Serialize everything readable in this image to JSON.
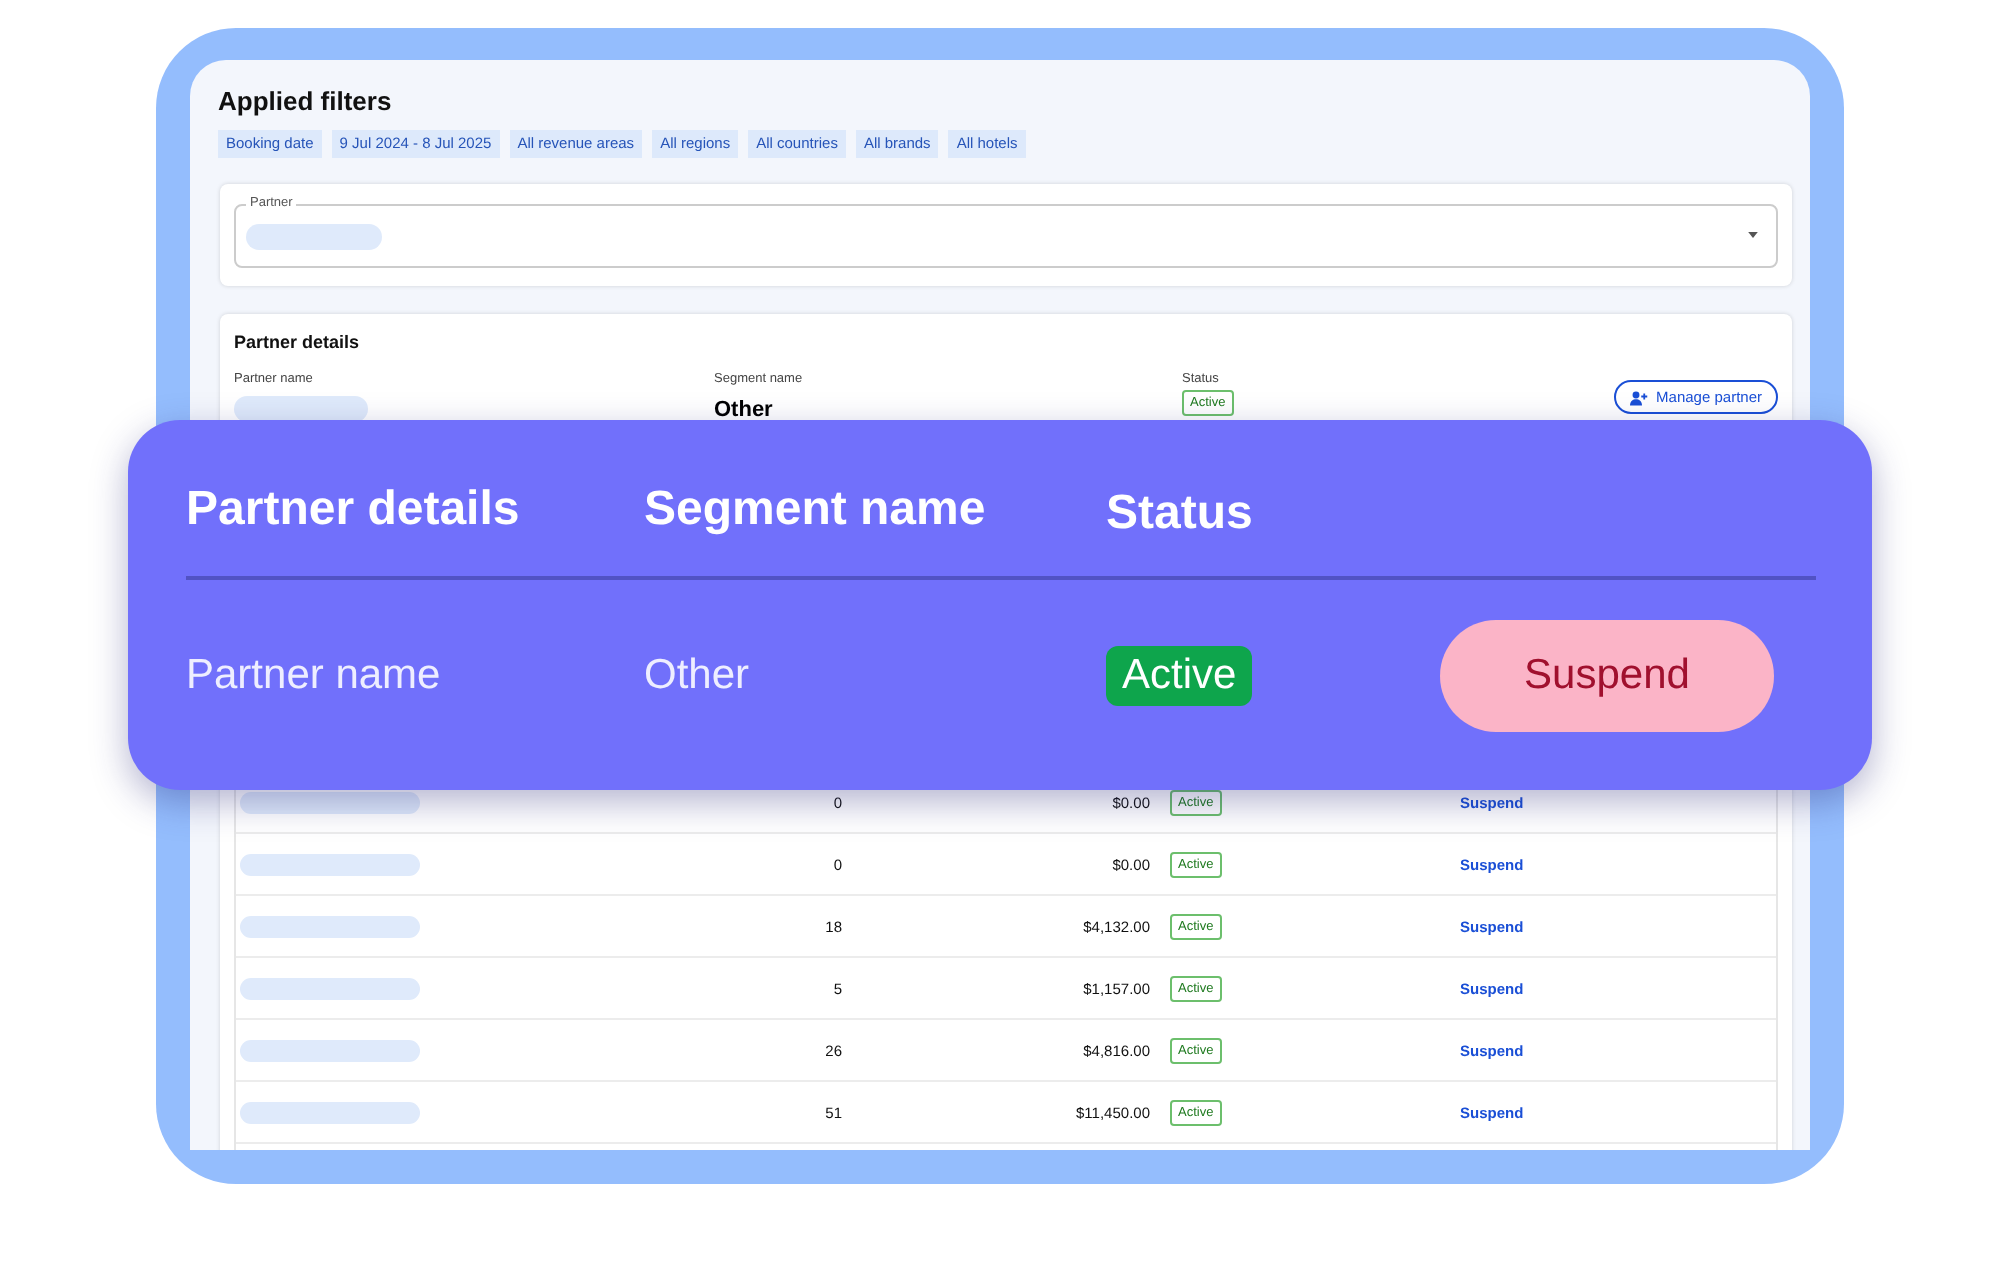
{
  "filters": {
    "title": "Applied filters",
    "chips": [
      "Booking date",
      "9 Jul 2024 - 8 Jul 2025",
      "All revenue areas",
      "All regions",
      "All countries",
      "All brands",
      "All hotels"
    ]
  },
  "partner_select": {
    "label": "Partner"
  },
  "partner_details": {
    "title": "Partner details",
    "fields": [
      {
        "label": "Partner name"
      },
      {
        "label": "Segment name",
        "value": "Other"
      },
      {
        "label": "Status",
        "value": "Active",
        "kind": "badge"
      }
    ],
    "manage_button": "Manage partner"
  },
  "table": {
    "rows": [
      {
        "column_2": "0",
        "column_3": "$0.00",
        "status": "Active",
        "action": "Suspend"
      },
      {
        "column_2": "0",
        "column_3": "$0.00",
        "status": "Active",
        "action": "Suspend"
      },
      {
        "column_2": "18",
        "column_3": "$4,132.00",
        "status": "Active",
        "action": "Suspend"
      },
      {
        "column_2": "5",
        "column_3": "$1,157.00",
        "status": "Active",
        "action": "Suspend"
      },
      {
        "column_2": "26",
        "column_3": "$4,816.00",
        "status": "Active",
        "action": "Suspend"
      },
      {
        "column_2": "51",
        "column_3": "$11,450.00",
        "status": "Active",
        "action": "Suspend"
      }
    ]
  },
  "callout": {
    "columns": [
      "Partner details",
      "Segment name",
      "Status"
    ],
    "row": {
      "name": "Partner name",
      "segment": "Other",
      "status": "Active",
      "action": "Suspend"
    }
  }
}
